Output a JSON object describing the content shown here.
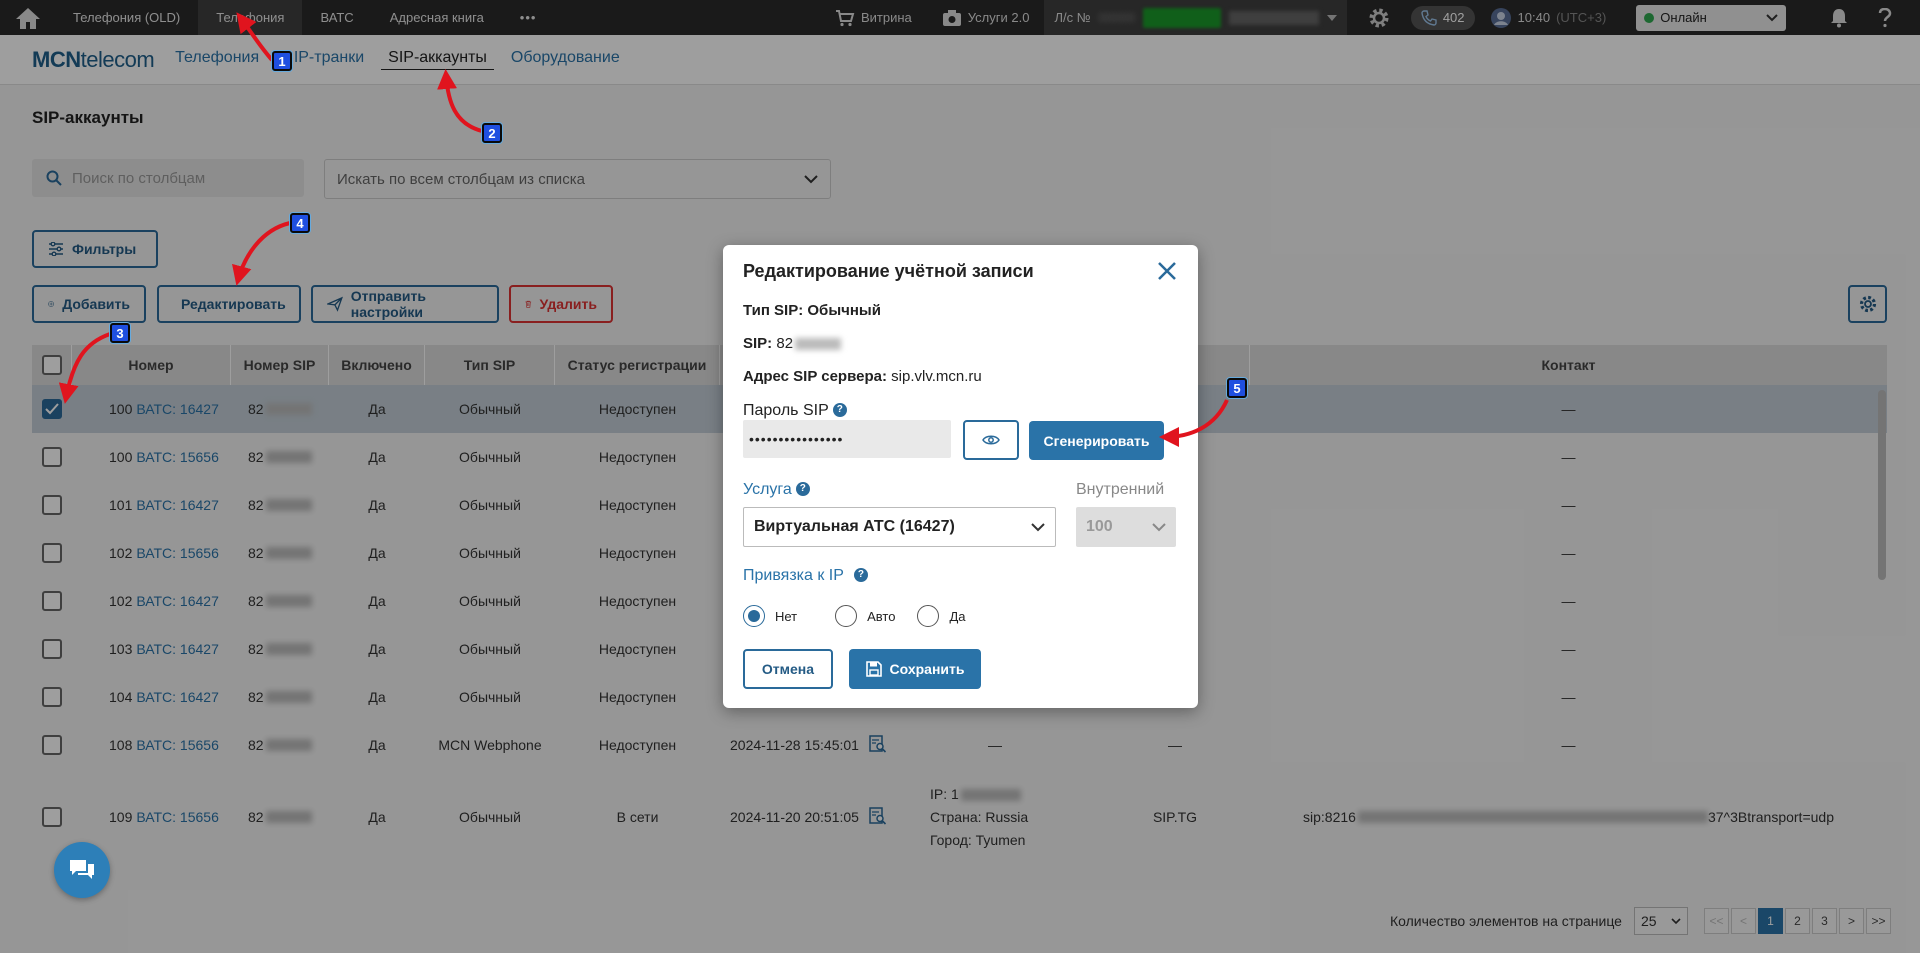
{
  "topbar": {
    "nav": [
      "Телефония (OLD)",
      "Телефония",
      "ВАТС",
      "Адресная книга"
    ],
    "storefront": "Витрина",
    "services": "Услуги 2.0",
    "account_prefix": "Л/с №",
    "calls_count": "402",
    "time": "10:40",
    "timezone": "(UTC+3)",
    "status": "Онлайн"
  },
  "brand": {
    "bold": "MCN",
    "light": "telecom"
  },
  "subnav": [
    "Телефония",
    "SIP-транки",
    "SIP-аккаунты",
    "Оборудование"
  ],
  "page_title": "SIP-аккаунты",
  "search": {
    "placeholder": "Поиск по столбцам"
  },
  "column_select": {
    "placeholder": "Искать по всем столбцам из списка"
  },
  "buttons": {
    "filters": "Фильтры",
    "add": "Добавить",
    "edit": "Редактировать",
    "send": "Отправить настройки",
    "delete": "Удалить"
  },
  "table": {
    "headers": [
      "Номер",
      "Номер SIP",
      "Включено",
      "Тип SIP",
      "Статус регистрации",
      "Контакт"
    ],
    "rows": [
      {
        "num": "100",
        "vats": "ВАТС: 16427",
        "sip": "82",
        "on": "Да",
        "type": "Обычный",
        "status": "Недоступен",
        "date": "",
        "ip": "",
        "country": "",
        "city": "",
        "ua": "",
        "contact": "—",
        "selected": true
      },
      {
        "num": "100",
        "vats": "ВАТС: 15656",
        "sip": "82",
        "on": "Да",
        "type": "Обычный",
        "status": "Недоступен",
        "date": "",
        "ip": "",
        "country": "",
        "city": "",
        "ua": "",
        "contact": "—",
        "selected": false
      },
      {
        "num": "101",
        "vats": "ВАТС: 16427",
        "sip": "82",
        "on": "Да",
        "type": "Обычный",
        "status": "Недоступен",
        "date": "",
        "ip": "",
        "country": "",
        "city": "",
        "ua": "",
        "contact": "—",
        "selected": false
      },
      {
        "num": "102",
        "vats": "ВАТС: 15656",
        "sip": "82",
        "on": "Да",
        "type": "Обычный",
        "status": "Недоступен",
        "date": "",
        "ip": "",
        "country": "",
        "city": "",
        "ua": "",
        "contact": "—",
        "selected": false
      },
      {
        "num": "102",
        "vats": "ВАТС: 16427",
        "sip": "82",
        "on": "Да",
        "type": "Обычный",
        "status": "Недоступен",
        "date": "",
        "ip": "",
        "country": "",
        "city": "",
        "ua": "",
        "contact": "—",
        "selected": false
      },
      {
        "num": "103",
        "vats": "ВАТС: 16427",
        "sip": "82",
        "on": "Да",
        "type": "Обычный",
        "status": "Недоступен",
        "date": "",
        "ip": "",
        "country": "",
        "city": "",
        "ua": "",
        "contact": "—",
        "selected": false
      },
      {
        "num": "104",
        "vats": "ВАТС: 16427",
        "sip": "82",
        "on": "Да",
        "type": "Обычный",
        "status": "Недоступен",
        "date": "",
        "ip": "",
        "country": "",
        "city": "",
        "ua": "",
        "contact": "—",
        "selected": false
      },
      {
        "num": "108",
        "vats": "ВАТС: 15656",
        "sip": "82",
        "on": "Да",
        "type": "MCN Webphone",
        "status": "Недоступен",
        "date": "2024-11-28 15:45:01",
        "ip": "—",
        "country": "",
        "city": "",
        "ua": "—",
        "contact": "—",
        "selected": false
      },
      {
        "num": "109",
        "vats": "ВАТС: 15656",
        "sip": "82",
        "on": "Да",
        "type": "Обычный",
        "status": "В сети",
        "date": "2024-11-20 20:51:05",
        "ip": "IP: 1",
        "country": "Страна: Russia",
        "city": "Город: Tyumen",
        "ua": "SIP.TG",
        "contact": "sip:8216",
        "contact_tail": "37^3Btransport=udp",
        "selected": false
      }
    ]
  },
  "pagination": {
    "label": "Количество элементов на странице",
    "per_page": "25",
    "first": "<<",
    "prev": "<",
    "pages": [
      "1",
      "2",
      "3"
    ],
    "next": ">",
    "last": ">>"
  },
  "modal": {
    "title": "Редактирование учётной записи",
    "sip_type": "Тип SIP: Обычный",
    "sip_label": "SIP:",
    "sip_value": "82",
    "server_label": "Адрес SIP сервера:",
    "server_value": "sip.vlv.mcn.ru",
    "password_label": "Пароль SIP",
    "password_value": "••••••••••••••••",
    "generate": "Сгенерировать",
    "service_label": "Услуга",
    "service_value": "Виртуальная АТС (16427)",
    "internal_label": "Внутренний",
    "internal_value": "100",
    "ip_label": "Привязка к IP",
    "radios": [
      "Нет",
      "Авто",
      "Да"
    ],
    "radio_selected": "Нет",
    "cancel": "Отмена",
    "save": "Сохранить"
  },
  "annotations": [
    "1",
    "2",
    "3",
    "4",
    "5"
  ],
  "colors": {
    "accent": "#2a73a8",
    "annotation": "#1f4fe0",
    "arrow": "#e0141e"
  }
}
